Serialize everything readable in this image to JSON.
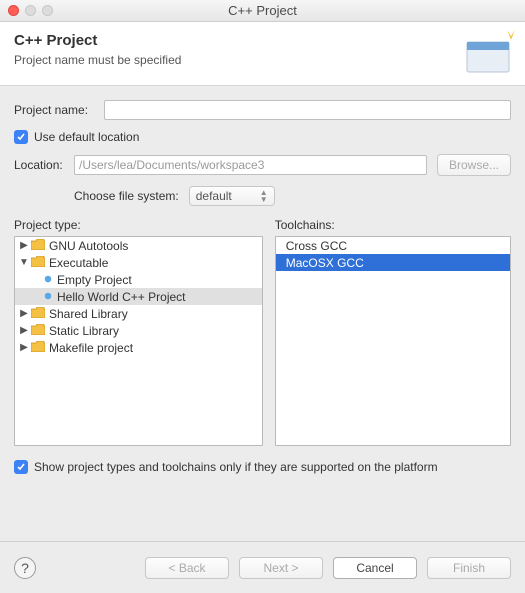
{
  "window": {
    "title": "C++ Project"
  },
  "header": {
    "title": "C++ Project",
    "subtitle": "Project name must be specified"
  },
  "form": {
    "project_name_label": "Project name:",
    "project_name_value": "",
    "use_default_location": "Use default location",
    "use_default_checked": true,
    "location_label": "Location:",
    "location_value": "/Users/lea/Documents/workspace3",
    "browse_label": "Browse...",
    "choose_fs_label": "Choose file system:",
    "fs_value": "default"
  },
  "project_type": {
    "label": "Project type:",
    "tree": [
      {
        "label": "GNU Autotools",
        "level": 0,
        "expanded": false,
        "kind": "folder",
        "selected": false
      },
      {
        "label": "Executable",
        "level": 0,
        "expanded": true,
        "kind": "folder",
        "selected": false
      },
      {
        "label": "Empty Project",
        "level": 1,
        "expanded": null,
        "kind": "leaf",
        "selected": false
      },
      {
        "label": "Hello World C++ Project",
        "level": 1,
        "expanded": null,
        "kind": "leaf",
        "selected": true
      },
      {
        "label": "Shared Library",
        "level": 0,
        "expanded": false,
        "kind": "folder",
        "selected": false
      },
      {
        "label": "Static Library",
        "level": 0,
        "expanded": false,
        "kind": "folder",
        "selected": false
      },
      {
        "label": "Makefile project",
        "level": 0,
        "expanded": false,
        "kind": "folder",
        "selected": false
      }
    ]
  },
  "toolchains": {
    "label": "Toolchains:",
    "items": [
      {
        "label": "Cross GCC",
        "selected": false
      },
      {
        "label": "MacOSX GCC",
        "selected": true
      }
    ]
  },
  "filter_checkbox": {
    "label": "Show project types and toolchains only if they are supported on the platform",
    "checked": true
  },
  "buttons": {
    "back": "< Back",
    "next": "Next >",
    "cancel": "Cancel",
    "finish": "Finish"
  },
  "icons": {
    "folder_fill": "#f5c145",
    "folder_stroke": "#c98f18",
    "leaf_fill": "#5aa8e6"
  }
}
